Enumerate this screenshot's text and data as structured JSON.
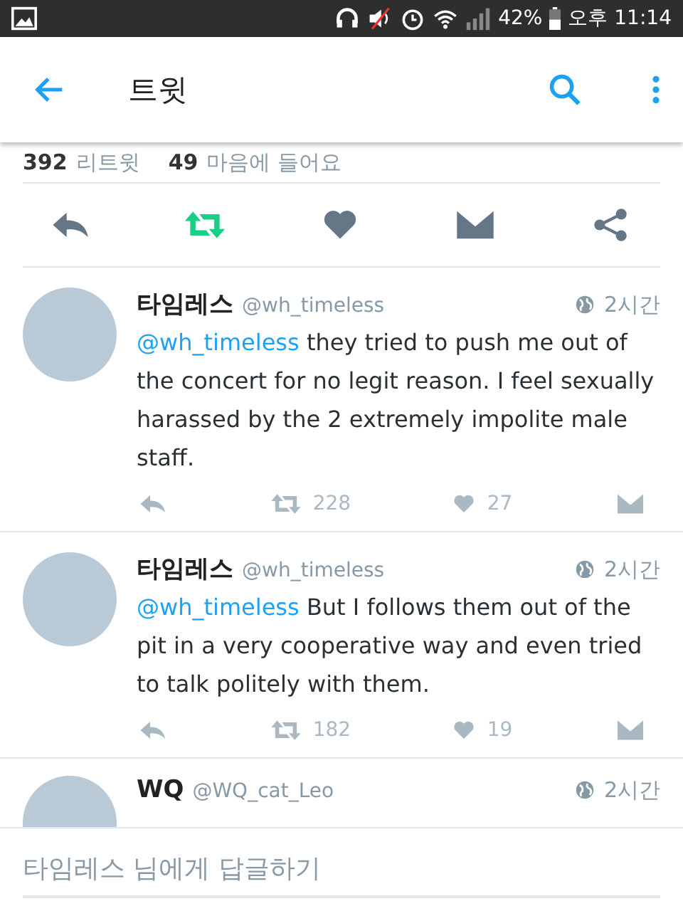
{
  "status_bar": {
    "battery": "42%",
    "time": "오후 11:14"
  },
  "app_bar": {
    "title": "트윗"
  },
  "stats": [
    {
      "count": "392",
      "label": "리트윗"
    },
    {
      "count": "49",
      "label": "마음에 들어요"
    }
  ],
  "actions": {
    "retweeted": true,
    "liked": false
  },
  "tweets": [
    {
      "name": "타임레스",
      "handle": "@wh_timeless",
      "time": "2시간",
      "mention": "@wh_timeless",
      "text": "they tried to push me out of the concert for no legit reason. I feel sexually harassed by the 2 extremely impolite male staff.",
      "retweets": "228",
      "likes": "27"
    },
    {
      "name": "타임레스",
      "handle": "@wh_timeless",
      "time": "2시간",
      "mention": "@wh_timeless",
      "text": "But I follows them out of the pit in a very cooperative way and even tried to talk politely with them.",
      "retweets": "182",
      "likes": "19"
    },
    {
      "name": "WQ",
      "handle": "@WQ_cat_Leo",
      "time": "2시간"
    }
  ],
  "reply": {
    "placeholder": "타임레스 님에게 답글하기"
  }
}
